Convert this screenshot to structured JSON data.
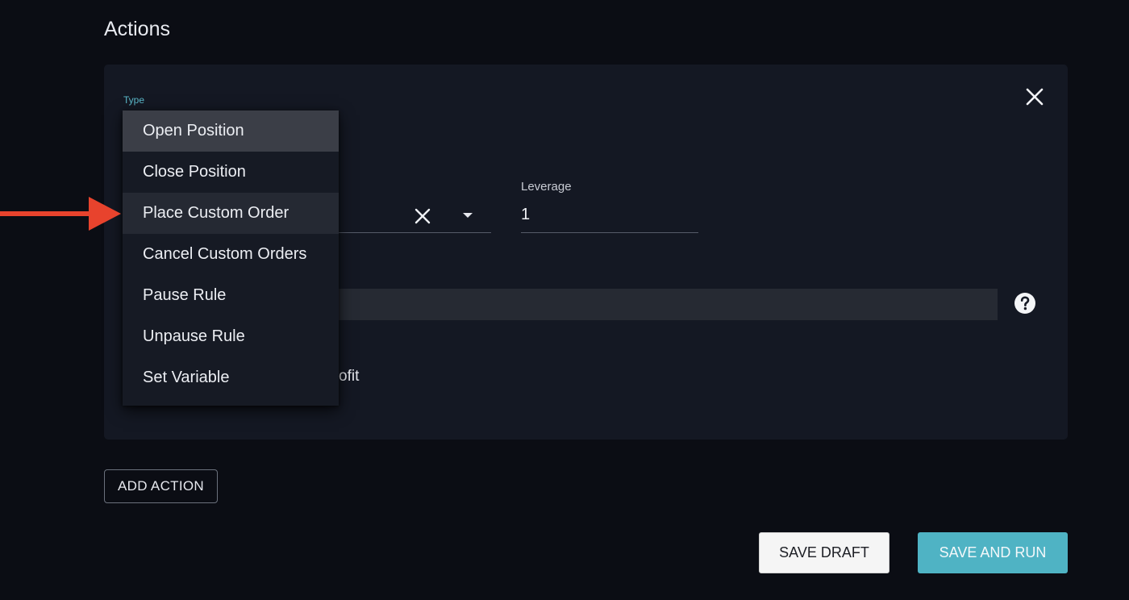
{
  "section": {
    "title": "Actions"
  },
  "card": {
    "type_label_peek": "Type",
    "leverage_label": "Leverage",
    "leverage_value": "1",
    "partial_text": "ofit"
  },
  "dropdown": {
    "items": [
      {
        "label": "Open Position",
        "state": "selected"
      },
      {
        "label": "Close Position",
        "state": "normal"
      },
      {
        "label": "Place Custom Order",
        "state": "hover"
      },
      {
        "label": "Cancel Custom Orders",
        "state": "normal"
      },
      {
        "label": "Pause Rule",
        "state": "normal"
      },
      {
        "label": "Unpause Rule",
        "state": "normal"
      },
      {
        "label": "Set Variable",
        "state": "normal"
      }
    ]
  },
  "buttons": {
    "add_action": "ADD ACTION",
    "save_draft": "SAVE DRAFT",
    "save_and_run": "SAVE AND RUN"
  },
  "colors": {
    "accent": "#4fb3c4",
    "pointer_arrow": "#e8432d",
    "background": "#0b0d14",
    "card": "#141823"
  },
  "icons": {
    "card_close": "close-icon",
    "field_clear": "clear-icon",
    "field_caret": "caret-down-icon",
    "help": "help-icon"
  }
}
